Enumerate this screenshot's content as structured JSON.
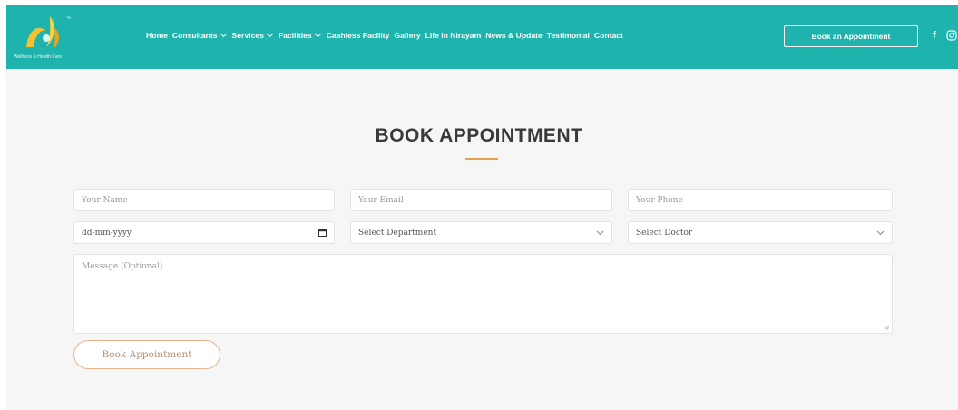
{
  "header": {
    "logo_text": "Wellness & Health Care",
    "nav": [
      {
        "label": "Home",
        "dropdown": false
      },
      {
        "label": "Consultants",
        "dropdown": true
      },
      {
        "label": "Services",
        "dropdown": true
      },
      {
        "label": "Facilities",
        "dropdown": true
      },
      {
        "label": "Cashless Facility",
        "dropdown": false
      },
      {
        "label": "Gallery",
        "dropdown": false
      },
      {
        "label": "Life in Nirayam",
        "dropdown": false
      },
      {
        "label": "News & Update",
        "dropdown": false
      },
      {
        "label": "Testimonial",
        "dropdown": false
      },
      {
        "label": "Contact",
        "dropdown": false
      }
    ],
    "book_button": "Book an Appointment",
    "social": {
      "facebook": "f",
      "instagram": "instagram-icon"
    },
    "colors": {
      "bar": "#1fb3ad",
      "text": "#ffffff"
    }
  },
  "form": {
    "title": "BOOK APPOINTMENT",
    "accent": "#e2a154",
    "name_placeholder": "Your Name",
    "email_placeholder": "Your Email",
    "phone_placeholder": "Your Phone",
    "date_value": "dd-mm-yyyy",
    "department_selected": "Select Department",
    "doctor_selected": "Select Doctor",
    "message_placeholder": "Message (Optional)",
    "submit_label": "Book Appointment"
  }
}
